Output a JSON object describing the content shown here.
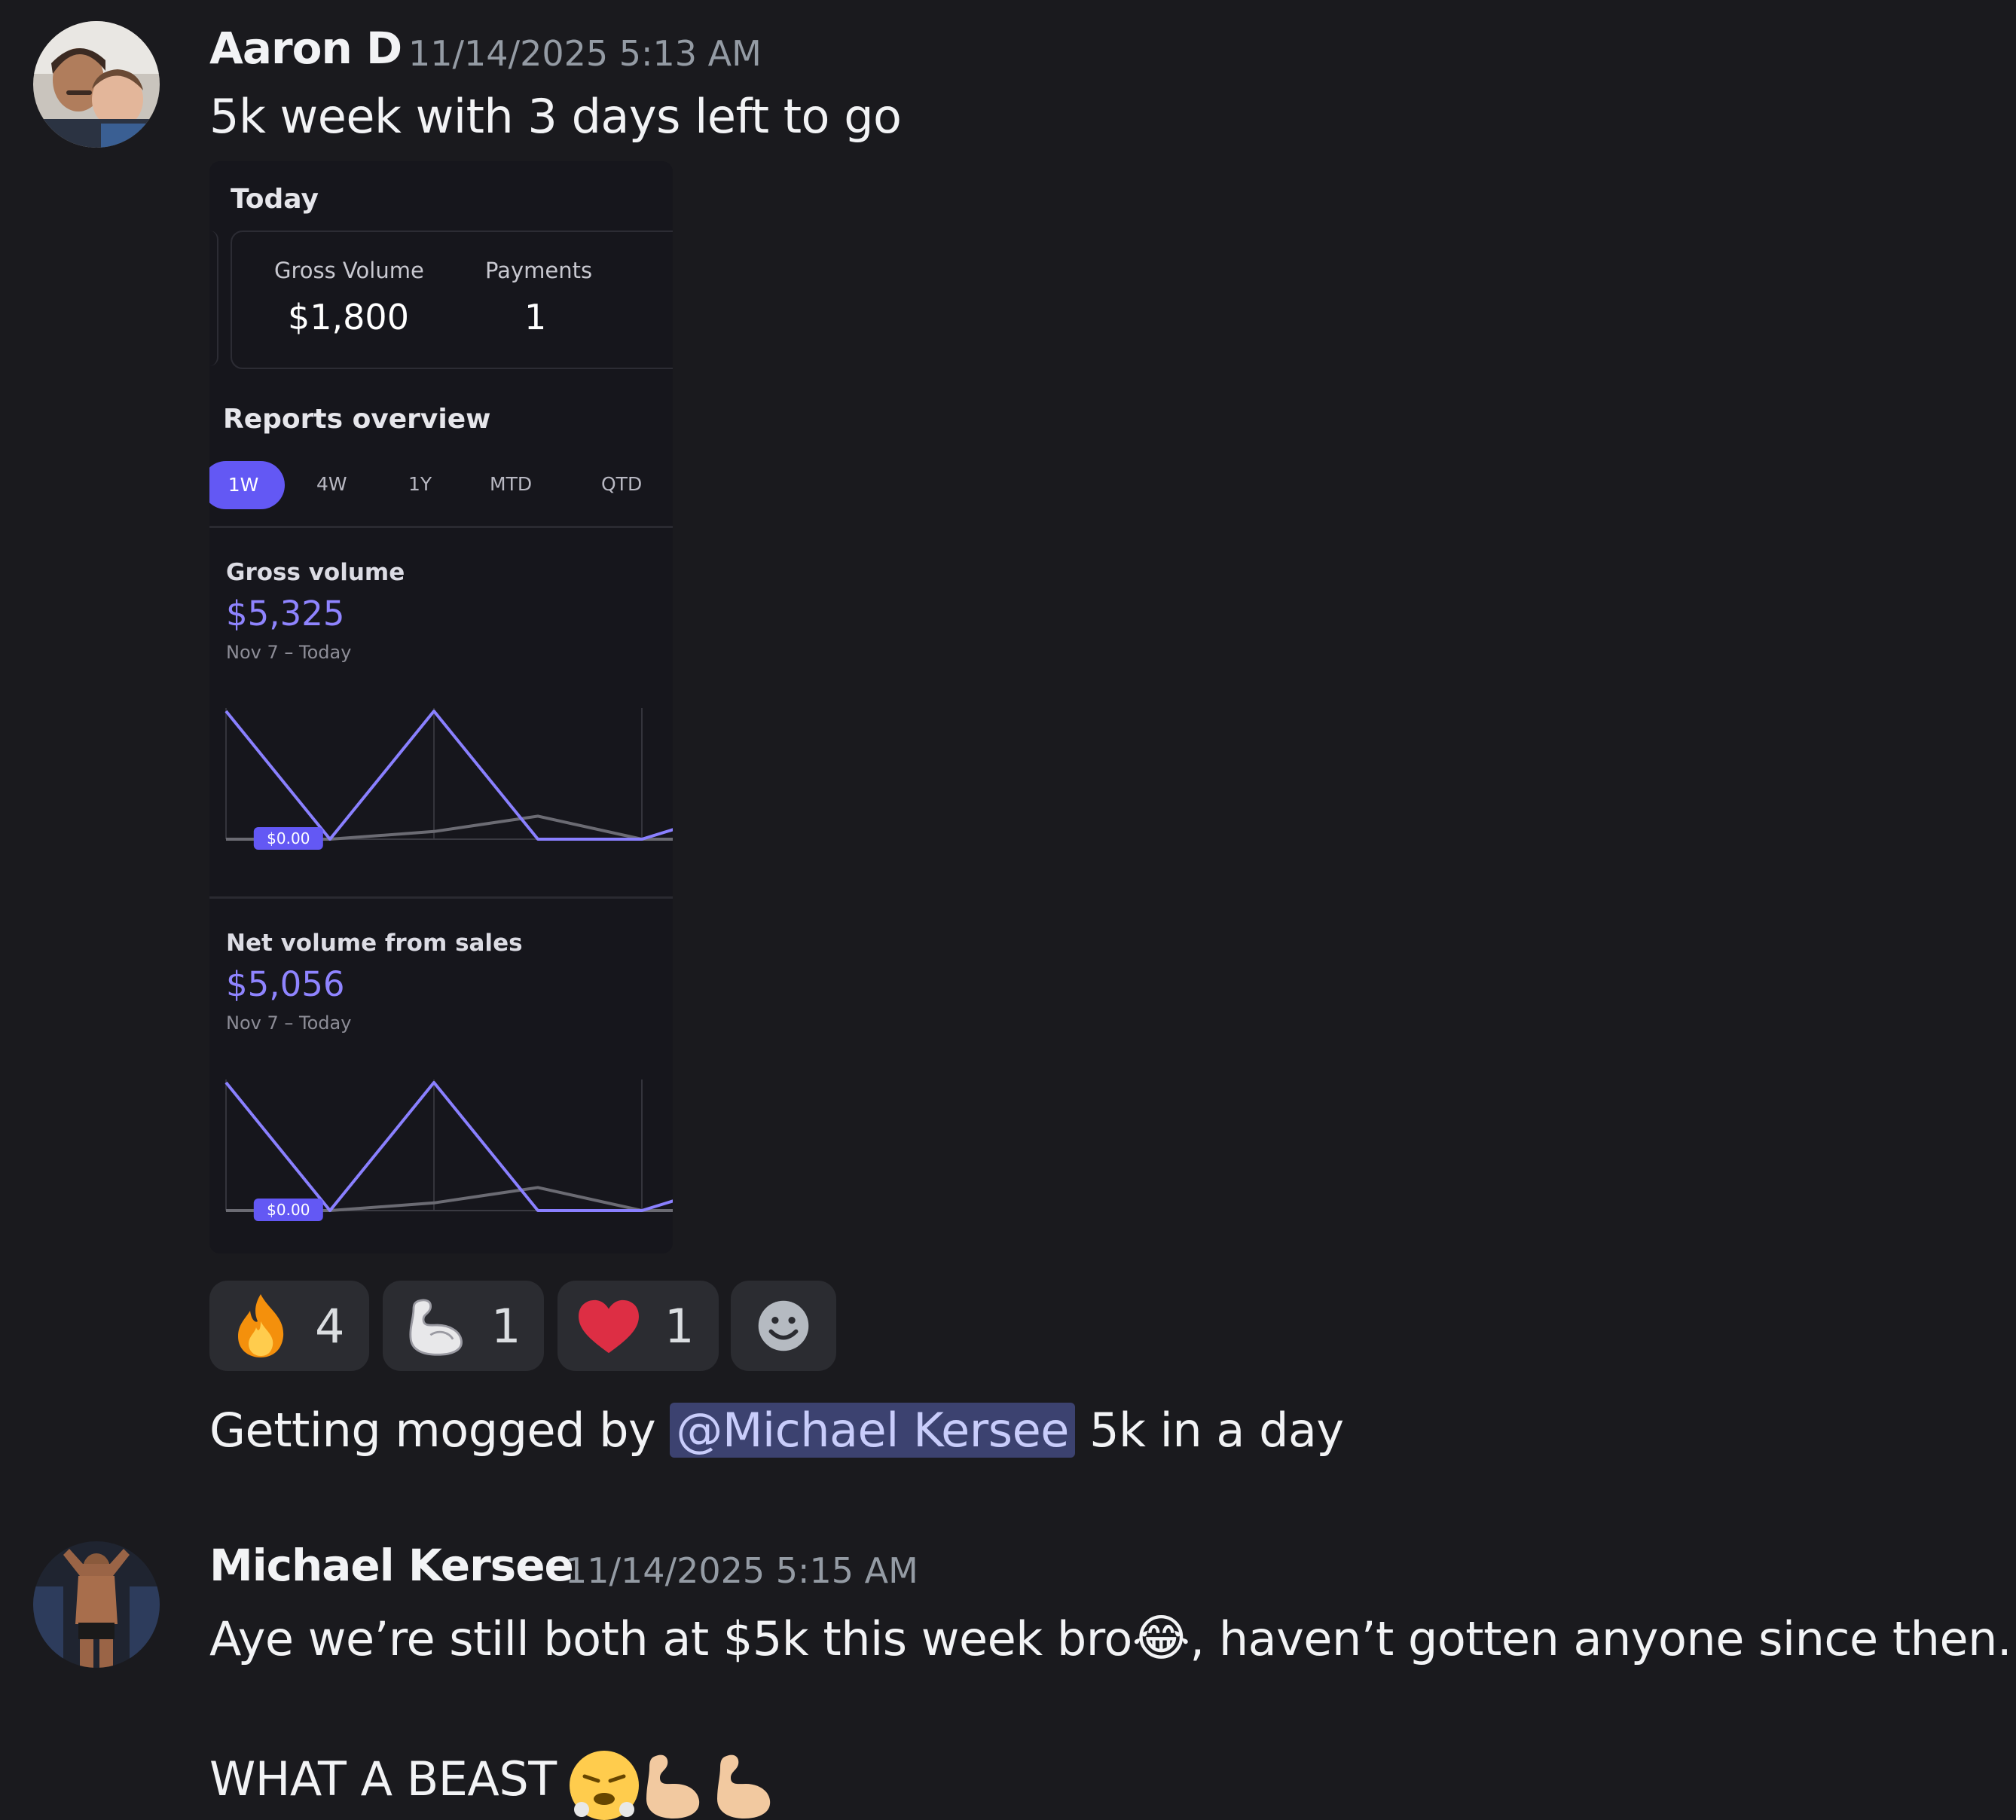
{
  "messages": [
    {
      "author": "Aaron D",
      "timestamp": "11/14/2025 5:13 AM",
      "text": "5k week with 3 days left to go"
    },
    {
      "author": "Michael Kersee",
      "timestamp": "11/14/2025 5:15 AM",
      "line1_a": "Aye we’re still both at $5k this week bro",
      "line1_emoji": "😂",
      "line1_b": ", haven’t gotten anyone since then.",
      "line2": "WHAT A BEAST"
    }
  ],
  "followup": {
    "before": "Getting mogged by ",
    "mention": "@Michael Kersee",
    "after": " 5k in a day"
  },
  "attachment": {
    "today_title": "Today",
    "gross_volume_label": "Gross Volume",
    "gross_volume_value": "$1,800",
    "payments_label": "Payments",
    "payments_value": "1",
    "reports_title": "Reports overview",
    "tabs": [
      "1W",
      "4W",
      "1Y",
      "MTD",
      "QTD"
    ],
    "active_tab": "1W",
    "gross_volume": {
      "label": "Gross volume",
      "value": "$5,325",
      "range": "Nov 7 – Today",
      "tooltip": "$0.00"
    },
    "net_volume": {
      "label": "Net volume from sales",
      "value": "$5,056",
      "range": "Nov 7 – Today",
      "tooltip": "$0.00"
    },
    "colors": {
      "accent": "#6358f4",
      "line": "#8a80ff",
      "previous": "#6b6b73"
    }
  },
  "chart_data": [
    {
      "type": "line",
      "title": "Gross volume",
      "series": [
        {
          "values": [
            1,
            0,
            1,
            0,
            0,
            0.25
          ]
        },
        {
          "values": [
            0,
            0,
            0.06,
            0.18,
            0,
            0
          ]
        }
      ],
      "grid": true
    },
    {
      "type": "line",
      "title": "Net volume from sales",
      "series": [
        {
          "values": [
            1,
            0,
            1,
            0,
            0,
            0.25
          ]
        },
        {
          "values": [
            0,
            0,
            0.06,
            0.18,
            0,
            0
          ]
        }
      ],
      "grid": true
    }
  ],
  "reactions": [
    {
      "icon": "fire-emoji-icon",
      "count": "4"
    },
    {
      "icon": "flexed-biceps-emoji-icon",
      "count": "1"
    },
    {
      "icon": "red-heart-emoji-icon",
      "count": "1"
    },
    {
      "icon": "add-reaction-icon"
    }
  ]
}
